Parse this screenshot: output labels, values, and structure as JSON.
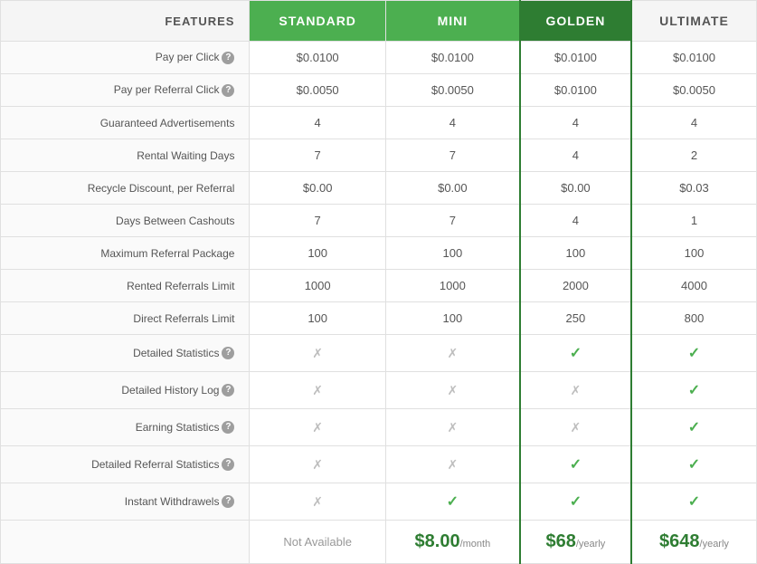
{
  "headers": {
    "features": "FEATURES",
    "standard": "STANDARD",
    "mini": "MINI",
    "golden": "GOLDEN",
    "ultimate": "ULTIMATE"
  },
  "rows": [
    {
      "feature": "Pay per Click",
      "has_info": true,
      "standard": "$0.0100",
      "mini": "$0.0100",
      "golden": "$0.0100",
      "ultimate": "$0.0100"
    },
    {
      "feature": "Pay per Referral Click",
      "has_info": true,
      "standard": "$0.0050",
      "mini": "$0.0050",
      "golden": "$0.0100",
      "ultimate": "$0.0050"
    },
    {
      "feature": "Guaranteed Advertisements",
      "has_info": false,
      "standard": "4",
      "mini": "4",
      "golden": "4",
      "ultimate": "4"
    },
    {
      "feature": "Rental Waiting Days",
      "has_info": false,
      "standard": "7",
      "mini": "7",
      "golden": "4",
      "ultimate": "2"
    },
    {
      "feature": "Recycle Discount, per Referral",
      "has_info": false,
      "standard": "$0.00",
      "mini": "$0.00",
      "golden": "$0.00",
      "ultimate": "$0.03"
    },
    {
      "feature": "Days Between Cashouts",
      "has_info": false,
      "standard": "7",
      "mini": "7",
      "golden": "4",
      "ultimate": "1"
    },
    {
      "feature": "Maximum Referral Package",
      "has_info": false,
      "standard": "100",
      "mini": "100",
      "golden": "100",
      "ultimate": "100"
    },
    {
      "feature": "Rented Referrals Limit",
      "has_info": false,
      "standard": "1000",
      "mini": "1000",
      "golden": "2000",
      "ultimate": "4000"
    },
    {
      "feature": "Direct Referrals Limit",
      "has_info": false,
      "standard": "100",
      "mini": "100",
      "golden": "250",
      "ultimate": "800"
    },
    {
      "feature": "Detailed Statistics",
      "has_info": true,
      "standard": "cross",
      "mini": "cross",
      "golden": "check",
      "ultimate": "check"
    },
    {
      "feature": "Detailed History Log",
      "has_info": true,
      "standard": "cross",
      "mini": "cross",
      "golden": "cross",
      "ultimate": "check"
    },
    {
      "feature": "Earning Statistics",
      "has_info": true,
      "standard": "cross",
      "mini": "cross",
      "golden": "cross",
      "ultimate": "check"
    },
    {
      "feature": "Detailed Referral Statistics",
      "has_info": true,
      "standard": "cross",
      "mini": "cross",
      "golden": "check",
      "ultimate": "check"
    },
    {
      "feature": "Instant Withdrawels",
      "has_info": true,
      "standard": "cross",
      "mini": "check",
      "golden": "check",
      "ultimate": "check"
    }
  ],
  "pricing": {
    "standard": {
      "text": "Not Available",
      "na": true
    },
    "mini": {
      "amount": "$8.00",
      "period": "/month",
      "na": false
    },
    "golden": {
      "amount": "$68",
      "period": "/yearly",
      "na": false
    },
    "ultimate": {
      "amount": "$648",
      "period": "/yearly",
      "na": false
    }
  }
}
